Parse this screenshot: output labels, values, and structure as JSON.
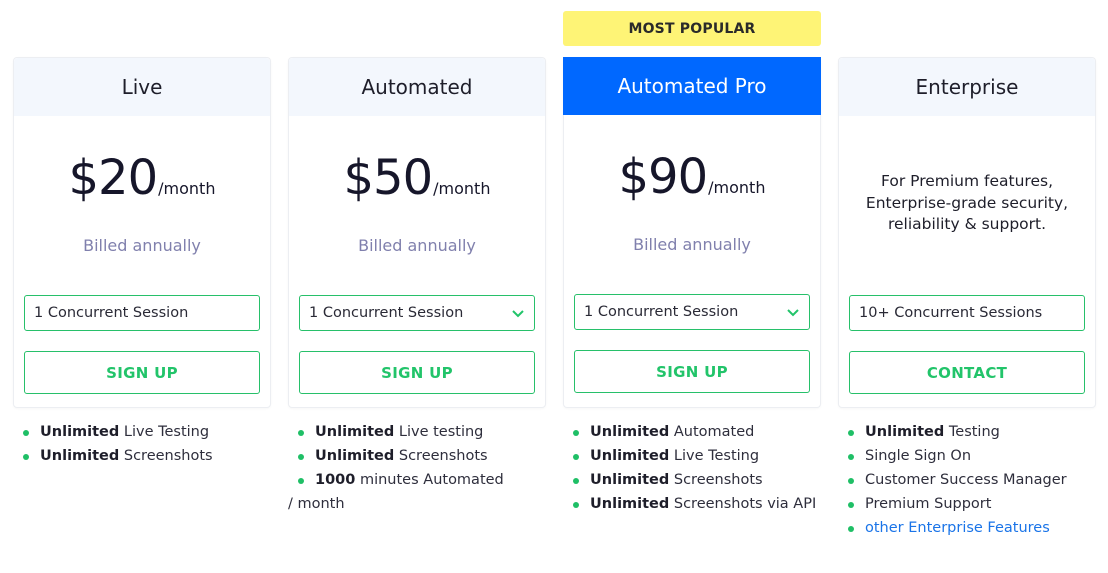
{
  "badge": {
    "label": "MOST POPULAR",
    "color": "#fef476"
  },
  "colors": {
    "accent_blue": "#0068ff",
    "green": "#22c46a",
    "header_bg": "#f3f7fd",
    "billed_text": "#8080ad",
    "link": "#1a74e8"
  },
  "plans": [
    {
      "name": "Live",
      "price": "$20",
      "period": "/month",
      "billing": "Billed annually",
      "sessions": "1 Concurrent Session",
      "sessions_dropdown": false,
      "cta": "SIGN UP",
      "features": [
        {
          "bold": "Unlimited",
          "text": " Live Testing"
        },
        {
          "bold": "Unlimited",
          "text": " Screenshots"
        }
      ]
    },
    {
      "name": "Automated",
      "price": "$50",
      "period": "/month",
      "billing": "Billed annually",
      "sessions": "1 Concurrent Session",
      "sessions_dropdown": true,
      "cta": "SIGN UP",
      "features": [
        {
          "bold": "Unlimited",
          "text": " Live testing"
        },
        {
          "bold": "Unlimited",
          "text": " Screenshots"
        },
        {
          "bold": "1000",
          "text": " minutes Automated / month"
        }
      ]
    },
    {
      "name": "Automated Pro",
      "price": "$90",
      "period": "/month",
      "billing": "Billed annually",
      "sessions": "1 Concurrent Session",
      "sessions_dropdown": true,
      "cta": "SIGN UP",
      "features": [
        {
          "bold": "Unlimited",
          "text": " Automated"
        },
        {
          "bold": "Unlimited",
          "text": " Live Testing"
        },
        {
          "bold": "Unlimited",
          "text": " Screenshots"
        },
        {
          "bold": "Unlimited",
          "text": " Screenshots via API"
        }
      ]
    },
    {
      "name": "Enterprise",
      "description": "For Premium features, Enterprise-grade security, reliability & support.",
      "sessions": "10+ Concurrent Sessions",
      "sessions_dropdown": false,
      "cta": "CONTACT",
      "features": [
        {
          "bold": "Unlimited",
          "text": " Testing"
        },
        {
          "bold": "",
          "text": "Single Sign On"
        },
        {
          "bold": "",
          "text": "Customer Success Manager"
        },
        {
          "bold": "",
          "text": "Premium Support"
        },
        {
          "link": "other Enterprise Features"
        }
      ]
    }
  ]
}
